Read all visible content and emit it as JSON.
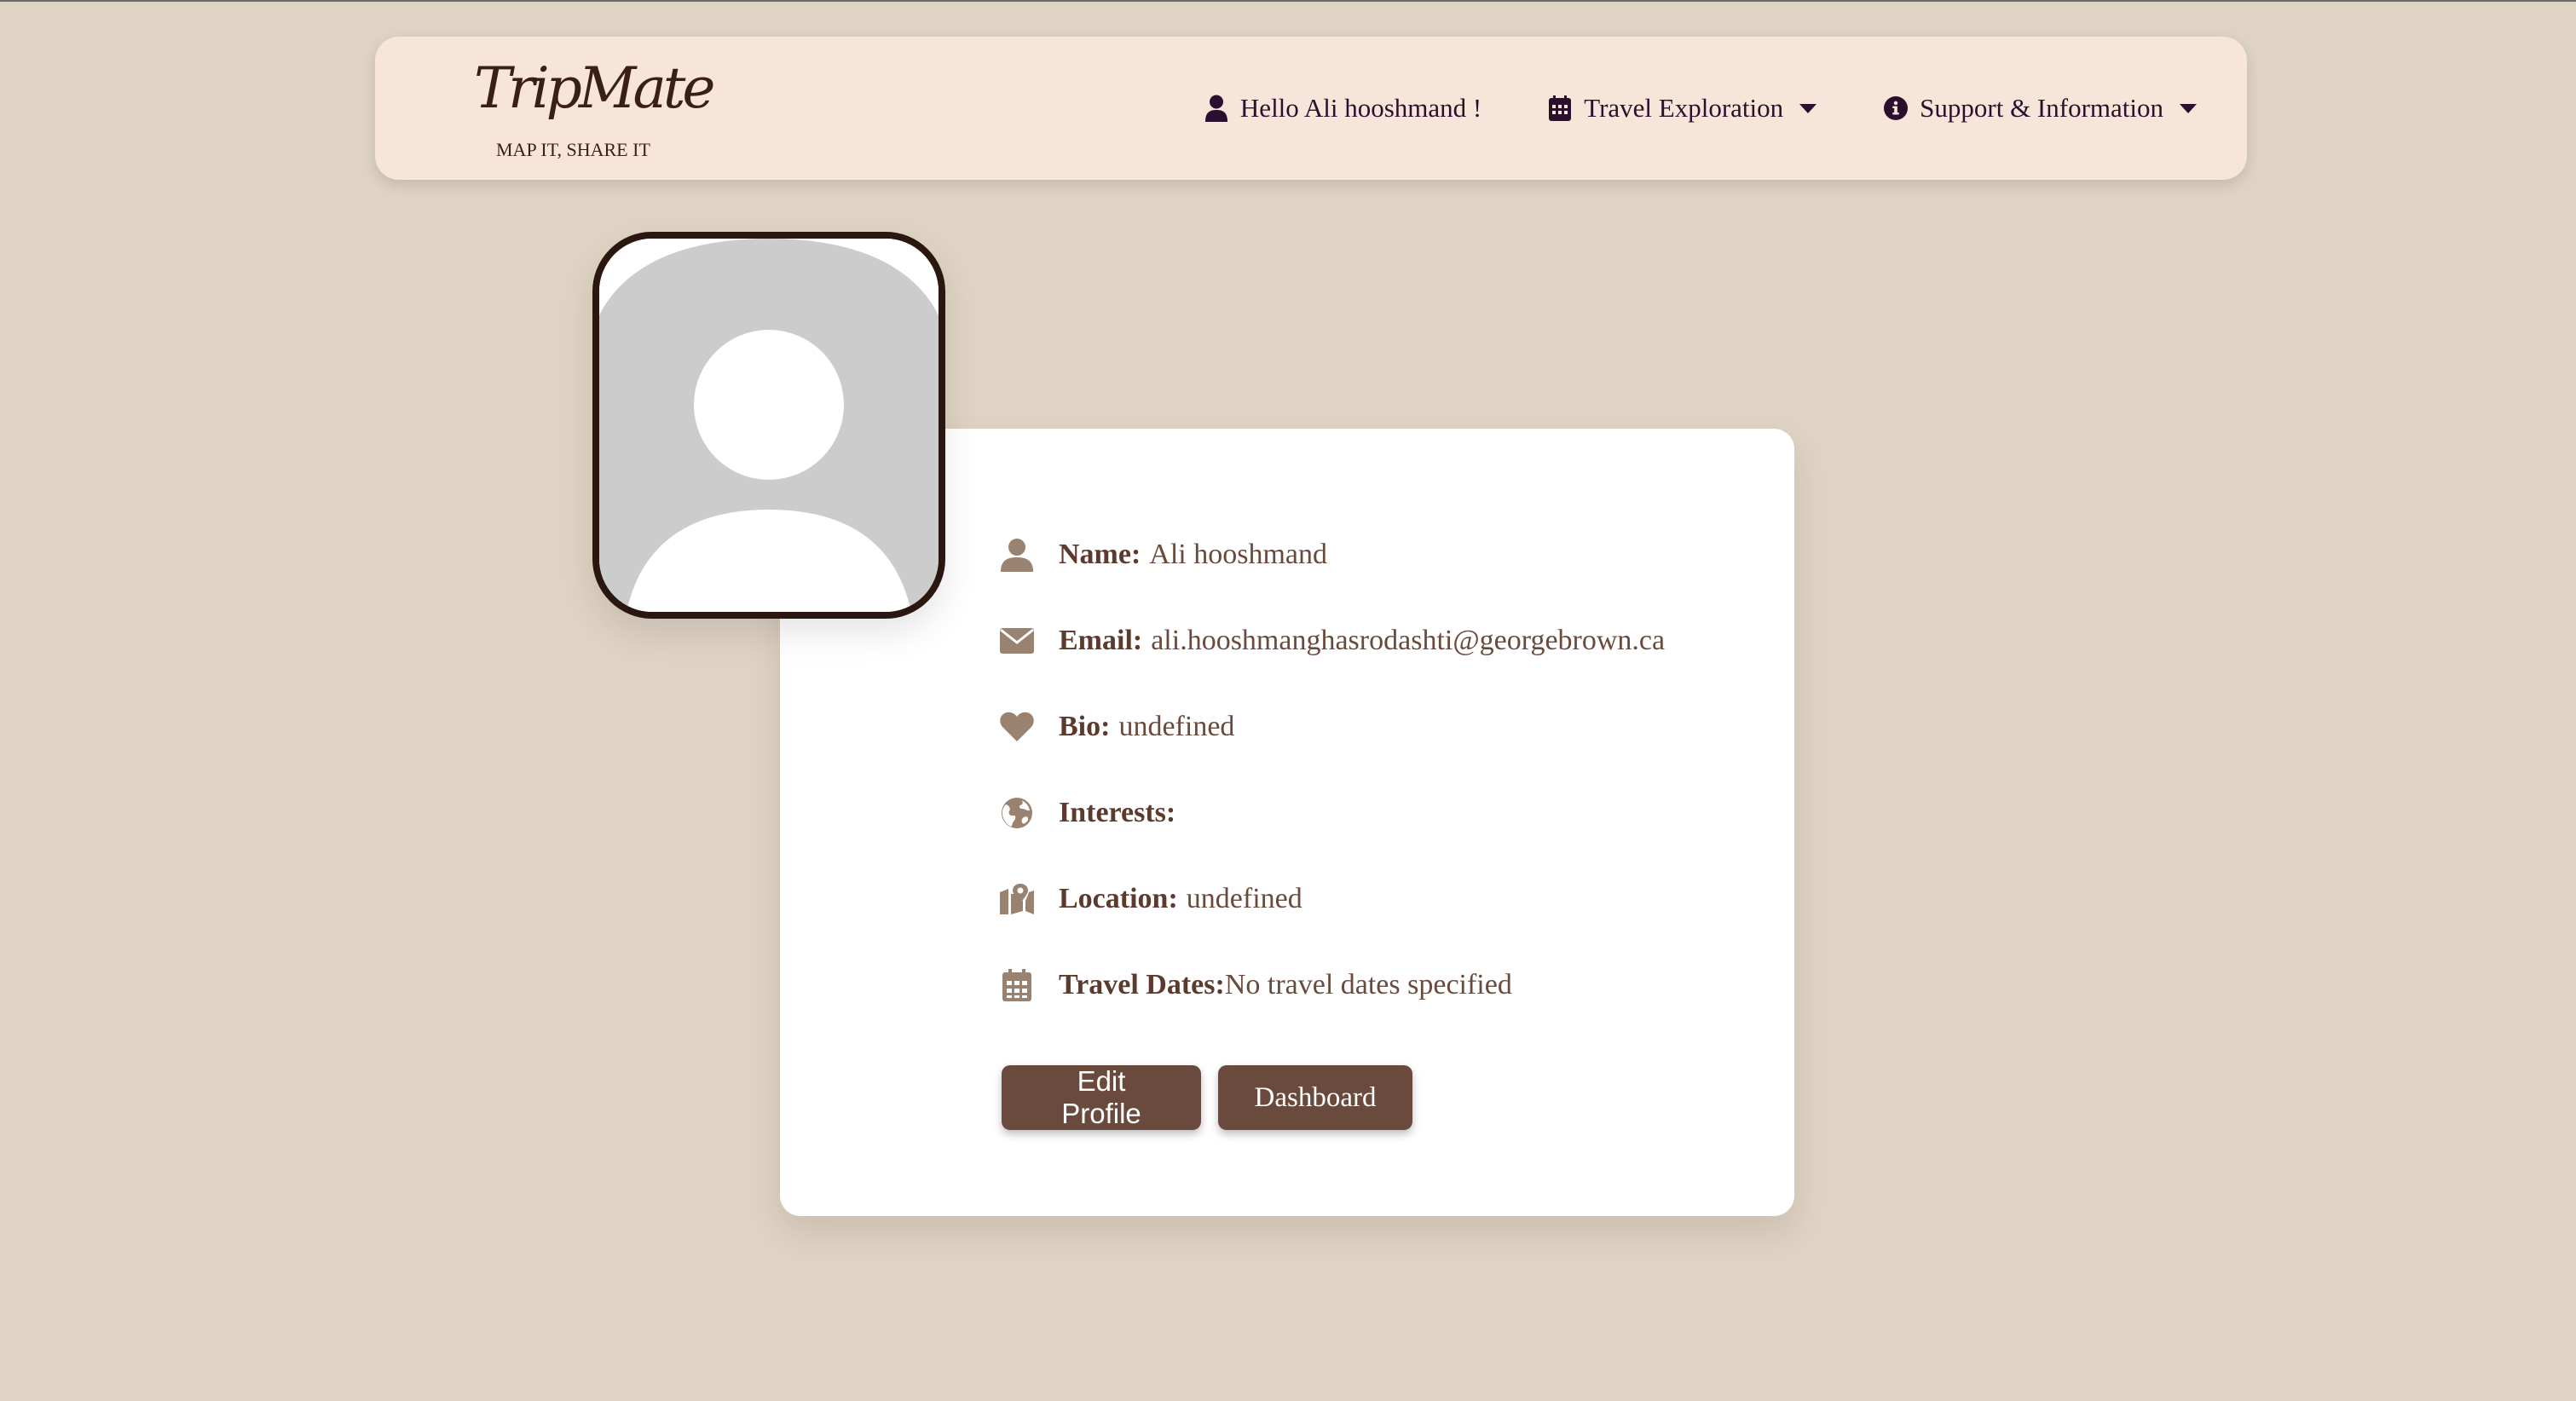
{
  "colors": {
    "page_background": "#dfd3c3",
    "navbar_background": "#f8e5d9",
    "card_background": "#ffffff",
    "accent": "#6b4a3e",
    "icon_muted": "#9a8270",
    "nav_text": "#2a0f2e"
  },
  "brand": {
    "name": "TripMate",
    "tagline": "MAP IT, SHARE IT"
  },
  "navbar": {
    "greeting": "Hello Ali hooshmand !",
    "greeting_icon": "user-icon",
    "travel_exploration": "Travel Exploration",
    "travel_icon": "calendar-icon",
    "support": "Support & Information",
    "support_icon": "info-circle-icon"
  },
  "profile": {
    "avatar": "default-avatar-placeholder",
    "fields": [
      {
        "icon": "user-icon",
        "label": "Name:",
        "value": "Ali hooshmand"
      },
      {
        "icon": "envelope-icon",
        "label": "Email:",
        "value": "ali.hooshmanghasrodashti@georgebrown.ca"
      },
      {
        "icon": "heart-icon",
        "label": "Bio:",
        "value": "undefined"
      },
      {
        "icon": "globe-icon",
        "label": "Interests:",
        "value": ""
      },
      {
        "icon": "map-location-icon",
        "label": "Location:",
        "value": "undefined"
      },
      {
        "icon": "calendar-icon",
        "label": "Travel Dates:",
        "value": "No travel dates specified"
      }
    ]
  },
  "actions": {
    "edit_profile": "Edit Profile",
    "dashboard": "Dashboard"
  }
}
